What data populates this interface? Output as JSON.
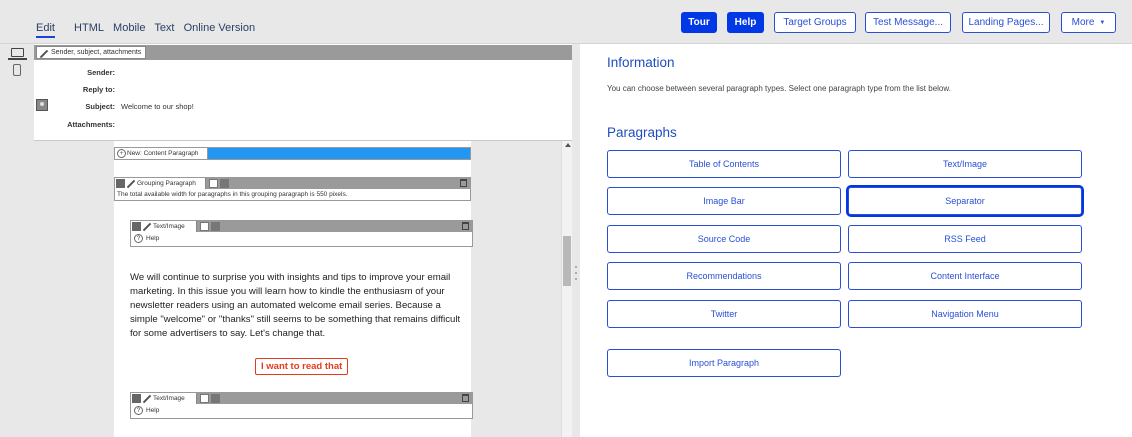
{
  "tabs": {
    "edit": "Edit",
    "html": "HTML",
    "mobile": "Mobile",
    "text": "Text",
    "online": "Online Version"
  },
  "toolbar": {
    "tour": "Tour",
    "help": "Help",
    "target_groups": "Target Groups",
    "test_message": "Test Message...",
    "landing_pages": "Landing Pages...",
    "more": "More",
    "more_arrow": "▼"
  },
  "header_block": {
    "label": "Sender, subject, attachments"
  },
  "meta": {
    "sender_label": "Sender:",
    "sender_value": "",
    "reply_label": "Reply to:",
    "reply_value": "",
    "subject_label": "Subject:",
    "subject_value": "Welcome to our shop!",
    "attachments_label": "Attachments:",
    "attachments_value": ""
  },
  "editor": {
    "new_paragraph": "New: Content Paragraph",
    "grouping_label": "Grouping Paragraph",
    "grouping_note": "The total available width for paragraphs in this grouping paragraph is 550 pixels.",
    "text_image_label": "Text/Image",
    "help": "Help",
    "body": "We will continue to surprise you with insights and tips to improve your email marketing. In this issue you will learn how to kindle the enthusiasm of your newsletter readers using an automated welcome email series. Because a simple \"welcome\" or \"thanks\" still seems to be something that remains difficult for some advertisers to say. Let's change that.",
    "cta": "I want to read that",
    "text_image_label2": "Text/Image",
    "help2": "Help"
  },
  "panel": {
    "info_title": "Information",
    "info_text": "You can choose between several paragraph types. Select one paragraph type from the list below.",
    "paragraphs_title": "Paragraphs",
    "buttons": [
      "Table of Contents",
      "Text/Image",
      "Image Bar",
      "Separator",
      "Source Code",
      "RSS Feed",
      "Recommendations",
      "Content Interface",
      "Twitter",
      "Navigation Menu",
      "Import Paragraph"
    ]
  },
  "colors": {
    "accent": "#0038e6",
    "link": "#2a4fd6",
    "cta": "#e53a1e",
    "new_bar": "#2196f3"
  },
  "icons": [
    "desktop-icon",
    "mobile-icon",
    "edit-icon",
    "avatar-icon",
    "add-icon",
    "copy-icon",
    "trash-icon",
    "help-icon"
  ]
}
